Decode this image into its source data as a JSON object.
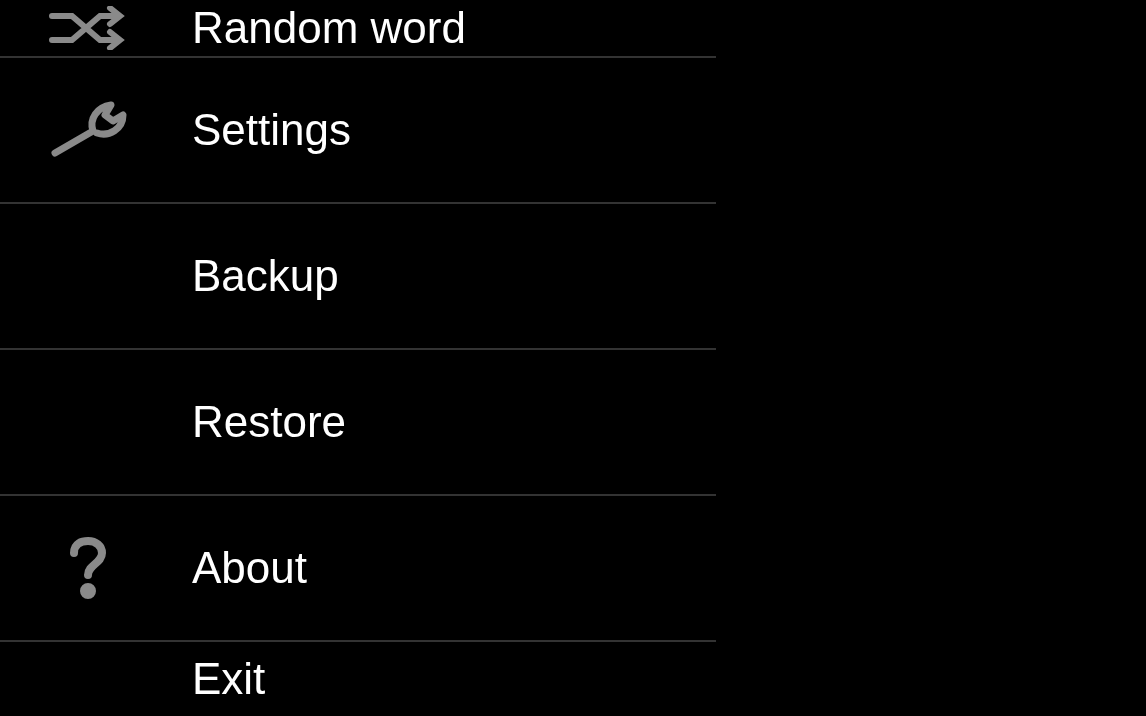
{
  "menu": {
    "items": [
      {
        "label": "Random word",
        "kind": "shuffle"
      },
      {
        "label": "Settings",
        "kind": "wrench"
      },
      {
        "label": "Backup",
        "kind": "plain"
      },
      {
        "label": "Restore",
        "kind": "plain"
      },
      {
        "label": "About",
        "kind": "help"
      },
      {
        "label": "Exit",
        "kind": "plain"
      }
    ]
  }
}
